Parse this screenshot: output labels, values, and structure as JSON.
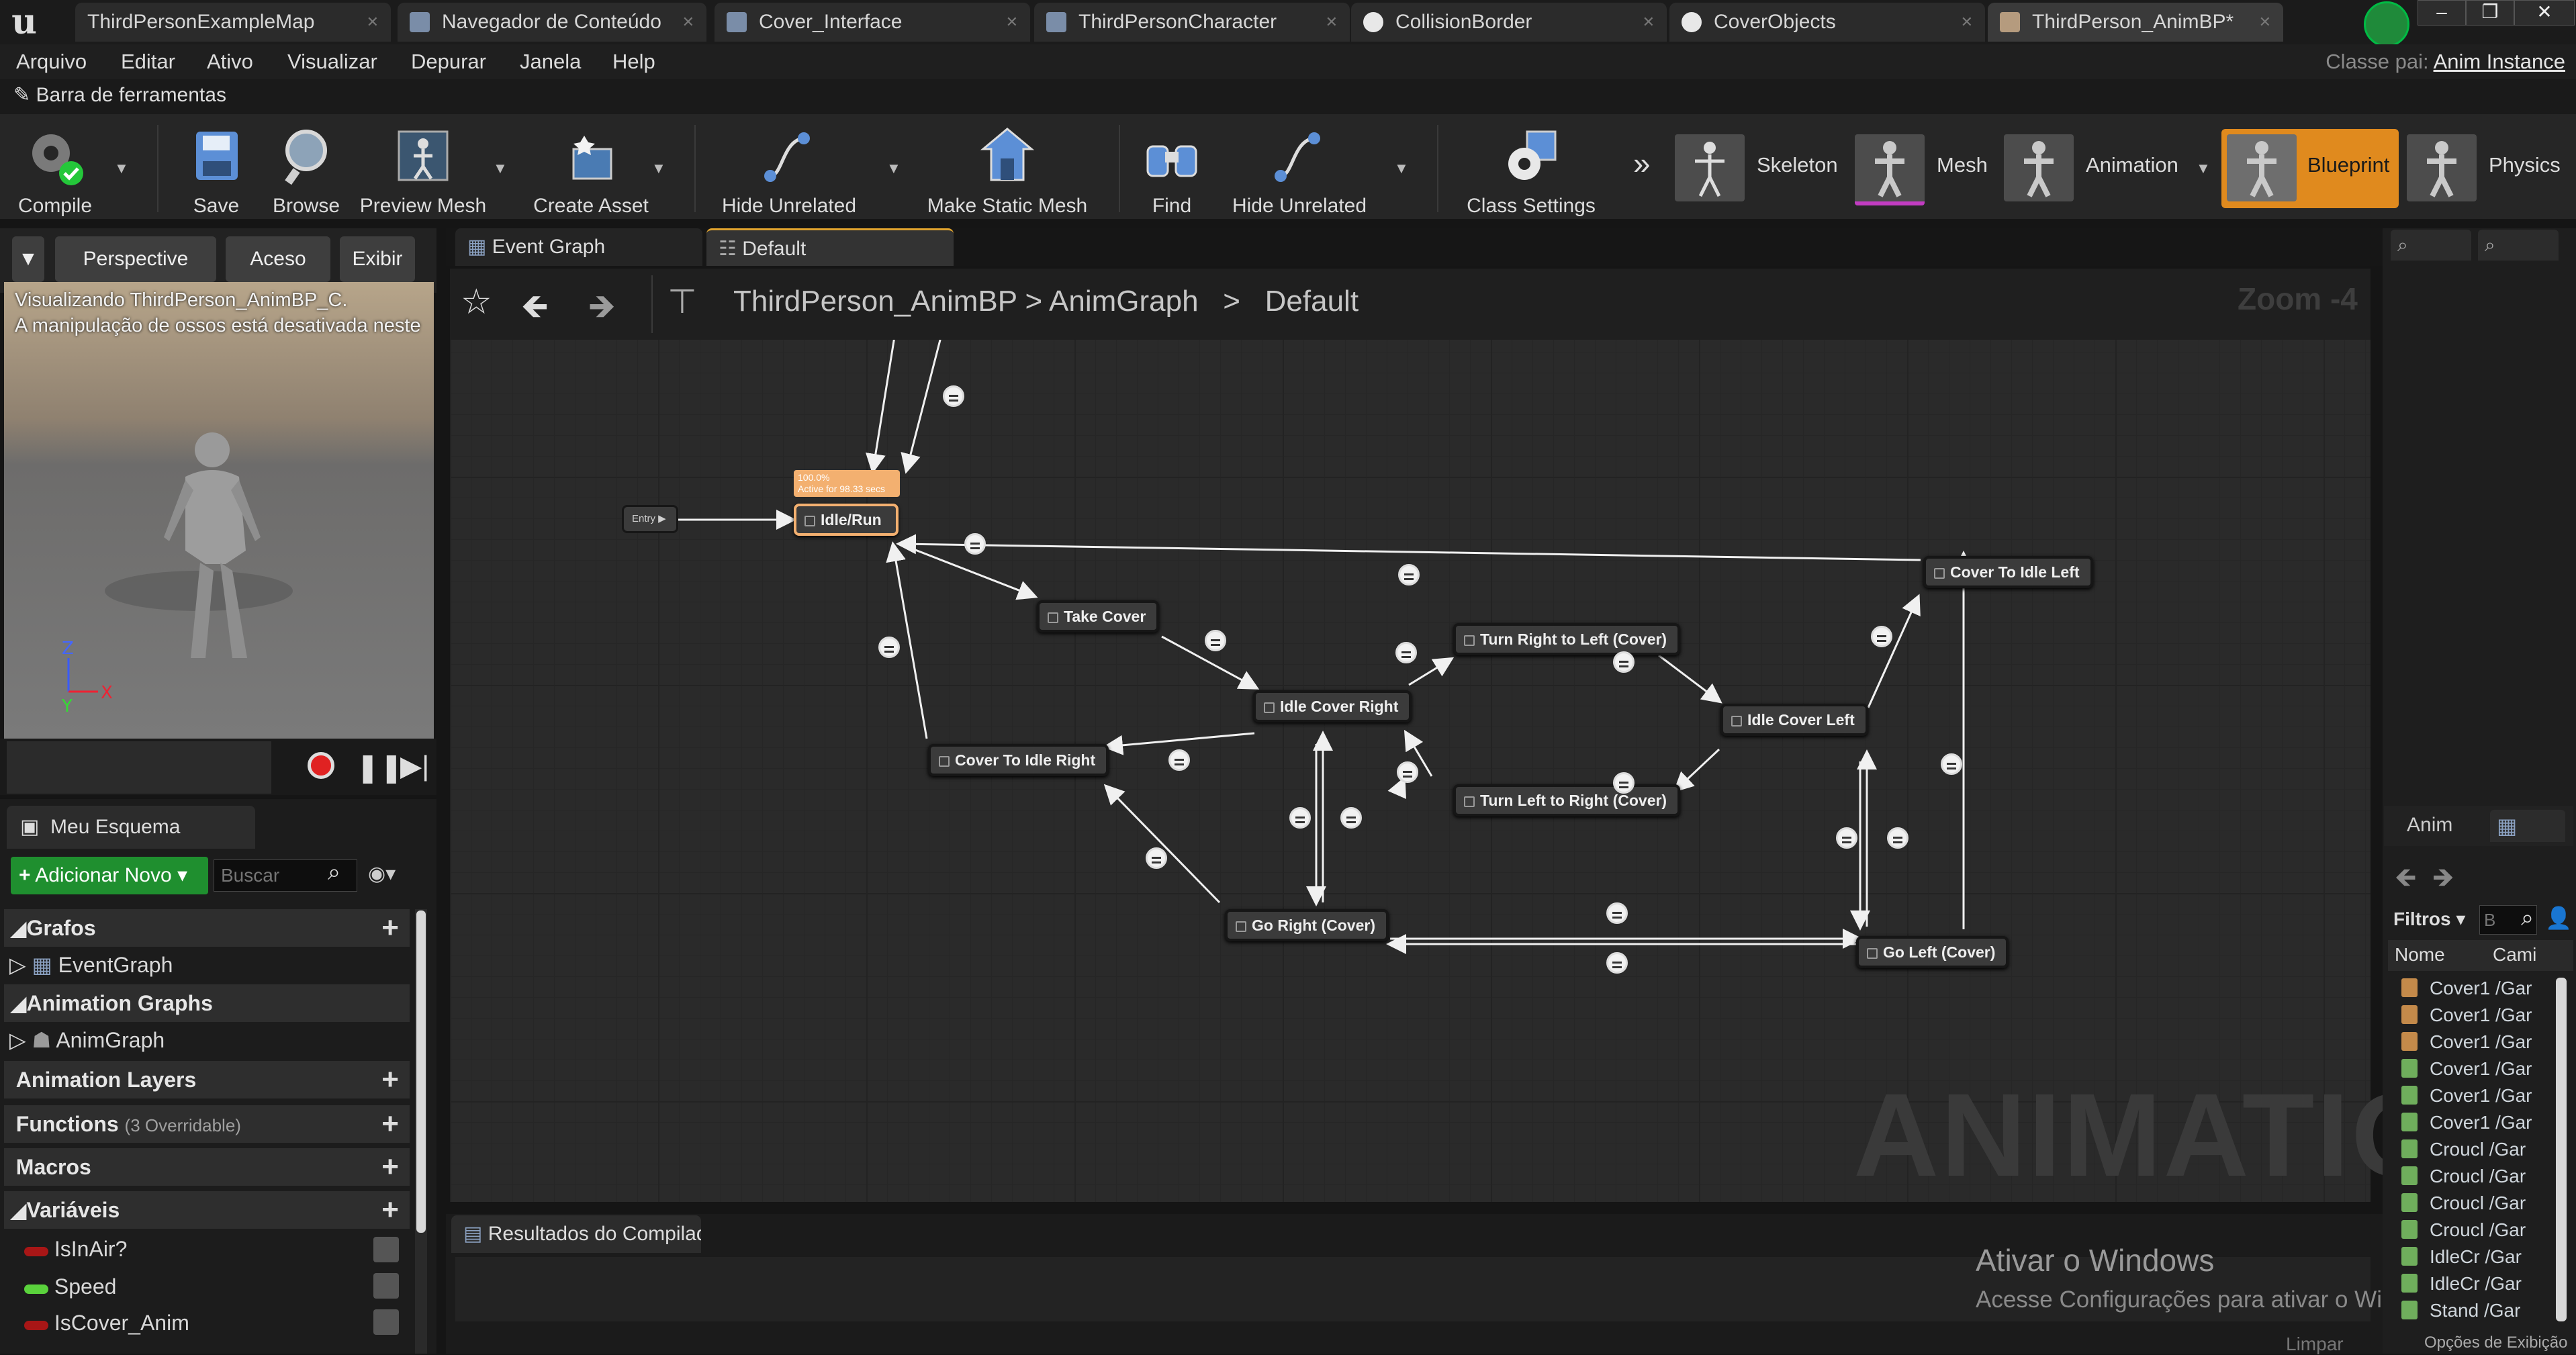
{
  "title_tabs": [
    {
      "label": "ThirdPersonExampleMap"
    },
    {
      "label": "Navegador de Conteúdo"
    },
    {
      "label": "Cover_Interface"
    },
    {
      "label": "ThirdPersonCharacter"
    },
    {
      "label": "CollisionBorder"
    },
    {
      "label": "CoverObjects"
    },
    {
      "label": "ThirdPerson_AnimBP*"
    }
  ],
  "menu": [
    "Arquivo",
    "Editar",
    "Ativo",
    "Visualizar",
    "Depurar",
    "Janela",
    "Help"
  ],
  "parent_class": {
    "label": "Classe pai:",
    "value": "Anim Instance"
  },
  "toolbar_header": "Barra de ferramentas",
  "toolbar": {
    "compile": "Compile",
    "save": "Save",
    "browse": "Browse",
    "preview_mesh": "Preview Mesh",
    "create_asset": "Create Asset",
    "hide_unrelated_1": "Hide Unrelated",
    "make_static_mesh": "Make Static Mesh",
    "find": "Find",
    "hide_unrelated_2": "Hide Unrelated",
    "class_settings": "Class Settings"
  },
  "modes": {
    "skeleton": "Skeleton",
    "mesh": "Mesh",
    "animation": "Animation",
    "blueprint": "Blueprint",
    "physics": "Physics"
  },
  "viewport": {
    "perspective": "Perspective",
    "aceso": "Aceso",
    "exibir": "Exibir",
    "info_line1": "Visualizando ThirdPerson_AnimBP_C.",
    "info_line2": "A manipulação de ossos está desativada neste"
  },
  "my_blueprint": {
    "tab": "Meu Esquema",
    "add_new": "Adicionar Novo",
    "search_placeholder": "Buscar",
    "sections": {
      "graphs": "Grafos",
      "event_graph": "EventGraph",
      "animation_graphs": "Animation Graphs",
      "anim_graph": "AnimGraph",
      "animation_layers": "Animation Layers",
      "functions": "Functions",
      "functions_note": "(3 Overridable)",
      "macros": "Macros",
      "variables": "Variáveis"
    },
    "variables": [
      {
        "name": "IsInAir?",
        "color": "#a81616"
      },
      {
        "name": "Speed",
        "color": "#5ad23c"
      },
      {
        "name": "IsCover_Anim",
        "color": "#a81616"
      }
    ]
  },
  "graph_tabs": [
    "Event Graph",
    "Default"
  ],
  "breadcrumb": [
    "ThirdPerson_AnimBP",
    "AnimGraph",
    "Default"
  ],
  "zoom": "Zoom -4",
  "watermark": "ANIMATION",
  "state_machine": {
    "entry": "Entry",
    "active_label_1": "100.0%",
    "active_label_2": "Active for 98.33 secs",
    "states": {
      "idle_run": "Idle/Run",
      "take_cover": "Take Cover",
      "idle_cover_right": "Idle Cover Right",
      "cover_to_idle_right": "Cover To Idle Right",
      "turn_right_to_left": "Turn Right to Left (Cover)",
      "turn_left_to_right": "Turn Left to Right (Cover)",
      "idle_cover_left": "Idle Cover Left",
      "cover_to_idle_left": "Cover To Idle Left",
      "go_right": "Go Right (Cover)",
      "go_left": "Go Left (Cover)"
    }
  },
  "results_tab": "Resultados do Compilador",
  "clear_label": "Limpar",
  "activate_windows": {
    "line1": "Ativar o Windows",
    "line2": "Acesse Configurações para ativar o Windows."
  },
  "right_panel": {
    "anim_tab": "Anim",
    "filters": "Filtros",
    "search_placeholder": "B",
    "col_name": "Nome",
    "col_path": "Cami",
    "assets": [
      {
        "name": "Cover1",
        "path": "/Gar",
        "kind": "orange"
      },
      {
        "name": "Cover1",
        "path": "/Gar",
        "kind": "orange"
      },
      {
        "name": "Cover1",
        "path": "/Gar",
        "kind": "orange"
      },
      {
        "name": "Cover1",
        "path": "/Gar",
        "kind": "green"
      },
      {
        "name": "Cover1",
        "path": "/Gar",
        "kind": "green"
      },
      {
        "name": "Cover1",
        "path": "/Gar",
        "kind": "green"
      },
      {
        "name": "Croucl",
        "path": "/Gar",
        "kind": "green"
      },
      {
        "name": "Croucl",
        "path": "/Gar",
        "kind": "green"
      },
      {
        "name": "Croucl",
        "path": "/Gar",
        "kind": "green"
      },
      {
        "name": "Croucl",
        "path": "/Gar",
        "kind": "green"
      },
      {
        "name": "IdleCr",
        "path": "/Gar",
        "kind": "green"
      },
      {
        "name": "IdleCr",
        "path": "/Gar",
        "kind": "green"
      },
      {
        "name": "Stand",
        "path": "/Gar",
        "kind": "green"
      }
    ],
    "options": "Opções de Exibição"
  }
}
